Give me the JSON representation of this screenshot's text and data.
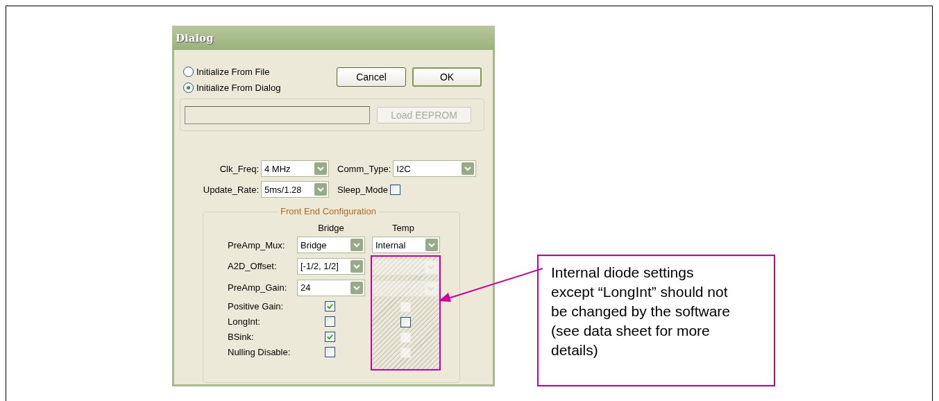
{
  "dialog": {
    "title": "Dialog",
    "init_options": [
      {
        "label": "Initialize From File",
        "selected": false
      },
      {
        "label": "Initialize From Dialog",
        "selected": true
      }
    ],
    "buttons": [
      {
        "label": "Cancel",
        "kind": "normal"
      },
      {
        "label": "OK",
        "kind": "default"
      }
    ],
    "load_button": {
      "label": "Load EEPROM",
      "disabled": true
    },
    "settings": [
      {
        "label": "Clk_Freq:",
        "kind": "dropdown",
        "value": "4 MHz"
      },
      {
        "label": "Comm_Type:",
        "kind": "dropdown",
        "value": "I2C"
      },
      {
        "label": "Update_Rate:",
        "kind": "dropdown",
        "value": "5ms/1.28"
      },
      {
        "label": "Sleep_Mode",
        "kind": "checkbox",
        "checked": false
      }
    ],
    "front_end": {
      "title": "Front End Configuration",
      "columns": [
        "Bridge",
        "Temp"
      ],
      "rows": [
        {
          "label": "PreAmp_Mux:",
          "kind": "dropdown",
          "bridge": {
            "value": "Bridge"
          },
          "temp": {
            "value": "Internal",
            "disabled": false
          }
        },
        {
          "label": "A2D_Offset:",
          "kind": "dropdown",
          "bridge": {
            "value": "[-1/2, 1/2]"
          },
          "temp": {
            "disabled": true
          }
        },
        {
          "label": "PreAmp_Gain:",
          "kind": "dropdown",
          "bridge": {
            "value": "24"
          },
          "temp": {
            "disabled": true
          }
        },
        {
          "label": "Positive Gain:",
          "kind": "checkbox",
          "bridge": {
            "checked": true
          },
          "temp": {
            "checked": false,
            "disabled": true
          }
        },
        {
          "label": "LongInt:",
          "kind": "checkbox",
          "bridge": {
            "checked": false
          },
          "temp": {
            "checked": false,
            "disabled": false
          }
        },
        {
          "label": "BSink:",
          "kind": "checkbox",
          "bridge": {
            "checked": true
          },
          "temp": {
            "checked": false,
            "disabled": true
          }
        },
        {
          "label": "Nulling Disable:",
          "kind": "checkbox",
          "bridge": {
            "checked": false
          },
          "temp": {
            "checked": false,
            "disabled": true
          }
        }
      ]
    }
  },
  "callout": {
    "text": "Internal diode settings except “LongInt” should not be changed by the software (see data sheet for more details)"
  }
}
